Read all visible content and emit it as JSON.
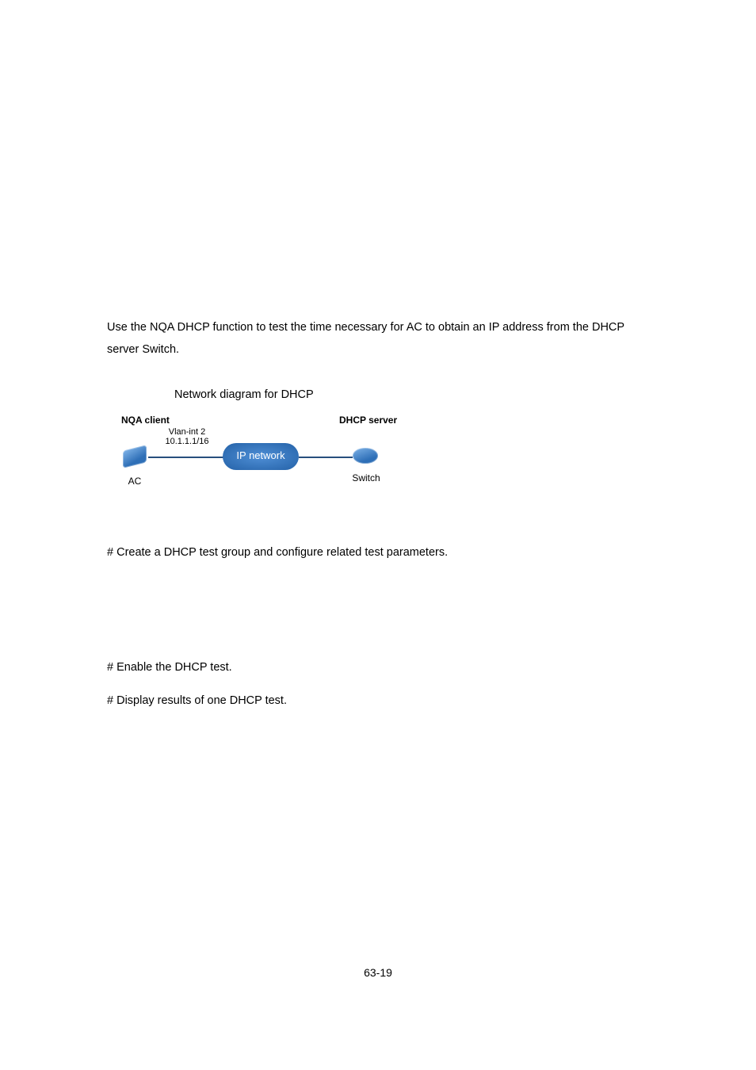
{
  "intro": "Use the NQA DHCP function to test the time necessary for AC to obtain an IP address from the DHCP server Switch.",
  "figure_caption": "Network diagram for DHCP",
  "diagram": {
    "left_role": "NQA client",
    "right_role": "DHCP server",
    "iface_line1": "Vlan-int 2",
    "iface_line2": "10.1.1.1/16",
    "cloud": "IP network",
    "left_device": "AC",
    "right_device": "Switch"
  },
  "step1": "# Create a DHCP test group and configure related test parameters.",
  "step2": "# Enable the DHCP test.",
  "step3": "# Display results of one DHCP test.",
  "page_number": "63-19"
}
